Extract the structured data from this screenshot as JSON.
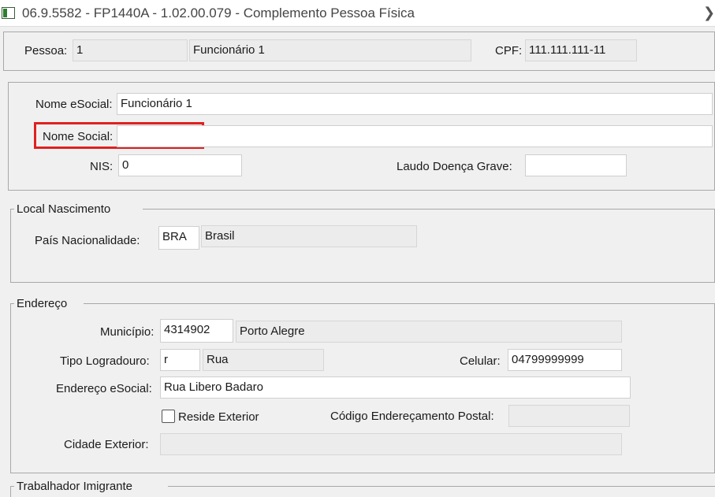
{
  "window": {
    "title": "06.9.5582 - FP1440A - 1.02.00.079 - Complemento Pessoa Física",
    "close_glyph": "❯"
  },
  "header": {
    "pessoa_label": "Pessoa:",
    "pessoa_code": "1",
    "pessoa_name": "Funcionário 1",
    "cpf_label": "CPF:",
    "cpf_value": "111.111.111-11"
  },
  "esocial": {
    "nome_esocial_label": "Nome eSocial:",
    "nome_esocial_value": "Funcionário 1",
    "nome_social_label": "Nome Social:",
    "nome_social_value": "",
    "nis_label": "NIS:",
    "nis_value": "0",
    "laudo_label": "Laudo Doença Grave:",
    "laudo_value": ""
  },
  "local_nascimento": {
    "title": "Local Nascimento",
    "pais_label": "País Nacionalidade:",
    "pais_code": "BRA",
    "pais_name": "Brasil"
  },
  "endereco": {
    "title": "Endereço",
    "municipio_label": "Município:",
    "municipio_code": "4314902",
    "municipio_name": "Porto Alegre",
    "tipo_label": "Tipo Logradouro:",
    "tipo_code": "r",
    "tipo_name": "Rua",
    "celular_label": "Celular:",
    "celular_value": "04799999999",
    "endereco_label": "Endereço eSocial:",
    "endereco_value": "Rua Libero Badaro",
    "reside_label": "Reside Exterior",
    "reside_checked": false,
    "cep_label": "Código Endereçamento Postal:",
    "cep_value": "",
    "cidade_label": "Cidade Exterior:",
    "cidade_value": ""
  },
  "trabalhador": {
    "title": "Trabalhador Imigrante"
  },
  "colors": {
    "highlight": "#e02020",
    "readonly_bg": "#ececec",
    "window_bg": "#f0f0f0"
  }
}
